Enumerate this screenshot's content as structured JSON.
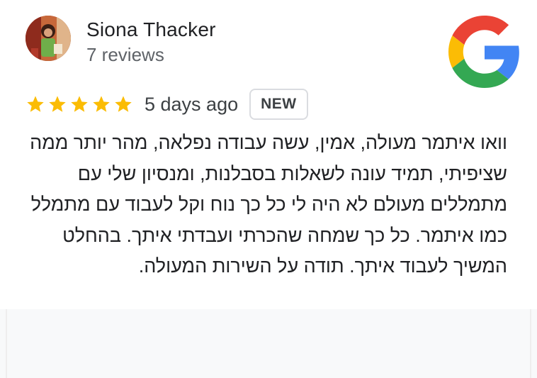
{
  "reviewer": {
    "name": "Siona Thacker",
    "review_count": "7 reviews",
    "avatar_icon": "profile-photo"
  },
  "brand": {
    "logo_icon": "google-g-icon",
    "colors": {
      "blue": "#4285F4",
      "red": "#EA4335",
      "yellow": "#FBBC05",
      "green": "#34A853"
    }
  },
  "rating": {
    "stars": 5,
    "max_stars": 5,
    "star_color": "#FBBC04",
    "time_ago": "5 days ago",
    "badge": "NEW"
  },
  "review": {
    "text": "וואו איתמר מעולה, אמין, עשה עבודה נפלאה, מהר יותר ממה שציפיתי, תמיד עונה לשאלות בסבלנות, ומנסיון שלי עם מתמללים מעולם לא היה לי כל כך נוח וקל לעבוד עם מתמלל כמו איתמר.  כל כך שמחה שהכרתי ועבדתי איתך. בהחלט המשיך לעבוד איתך. תודה על השירות המעולה."
  }
}
